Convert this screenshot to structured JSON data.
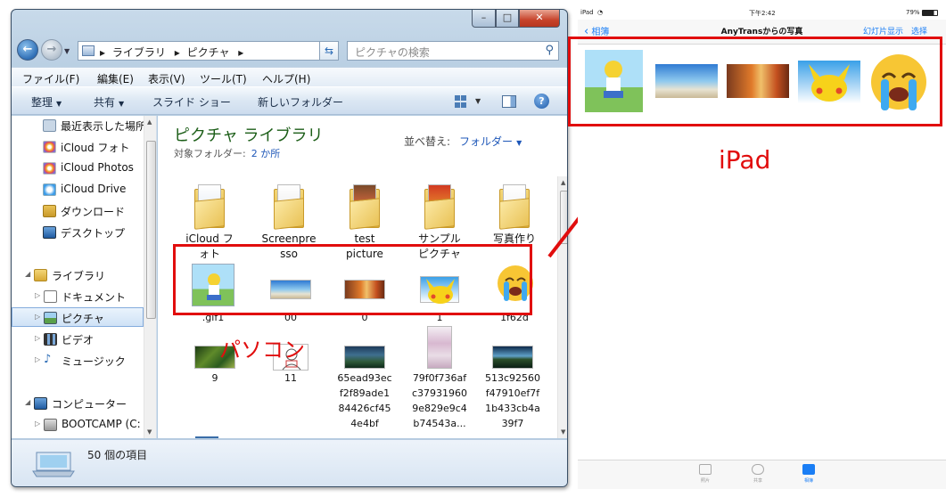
{
  "explorer": {
    "address": [
      "ライブラリ",
      "ピクチャ"
    ],
    "search_placeholder": "ピクチャの検索",
    "menu": [
      "ファイル(F)",
      "編集(E)",
      "表示(V)",
      "ツール(T)",
      "ヘルプ(H)"
    ],
    "toolbar": [
      "整理",
      "共有",
      "スライド ショー",
      "新しいフォルダー"
    ],
    "nav": {
      "items": [
        "最近表示した場所",
        "iCloud フォト",
        "iCloud Photos",
        "iCloud Drive",
        "ダウンロード",
        "デスクトップ"
      ],
      "library": "ライブラリ",
      "library_items": [
        "ドキュメント",
        "ピクチャ",
        "ビデオ",
        "ミュージック"
      ],
      "computer": "コンピューター",
      "computer_items": [
        "BOOTCAMP (C:"
      ]
    },
    "library_title": "ピクチャ ライブラリ",
    "library_subtitle": "対象フォルダー:",
    "library_locations": "2 か所",
    "sort_label": "並べ替え:",
    "sort_value": "フォルダー",
    "folders": [
      {
        "line1": "iCloud フ",
        "line2": "ォト"
      },
      {
        "line1": "Screenpre",
        "line2": "sso"
      },
      {
        "line1": "test",
        "line2": "picture"
      },
      {
        "line1": "サンプル",
        "line2": "ピクチャ"
      },
      {
        "line1": "写真作り",
        "line2": ""
      }
    ],
    "highlighted_files": [
      ".gif1",
      "00",
      "0",
      "1",
      "1f62d"
    ],
    "files": [
      {
        "lines": [
          "9"
        ]
      },
      {
        "lines": [
          "11"
        ]
      },
      {
        "lines": [
          "65ead93ec",
          "f2f89ade1",
          "84426cf45",
          "4e4bf"
        ]
      },
      {
        "lines": [
          "79f0f736af",
          "c37931960",
          "9e829e9c4",
          "b74543a..."
        ]
      },
      {
        "lines": [
          "513c92560",
          "f47910ef7f",
          "1b433cb4a",
          "39f7"
        ]
      }
    ],
    "status": "50 個の項目"
  },
  "annotations": {
    "pc_label": "パソコン",
    "ipad_label": "iPad"
  },
  "ipad": {
    "status_left": "iPad",
    "status_time": "下午2:42",
    "status_battery": "79%",
    "back": "相簿",
    "title": "AnyTransからの写真",
    "action1": "幻灯片显示",
    "action2": "选择",
    "tabs": [
      "照片",
      "共享",
      "相簿"
    ]
  },
  "colors": {
    "annotation_red": "#e10d0d",
    "ios_blue": "#1a7ef5",
    "library_title_green": "#1c5e18"
  }
}
